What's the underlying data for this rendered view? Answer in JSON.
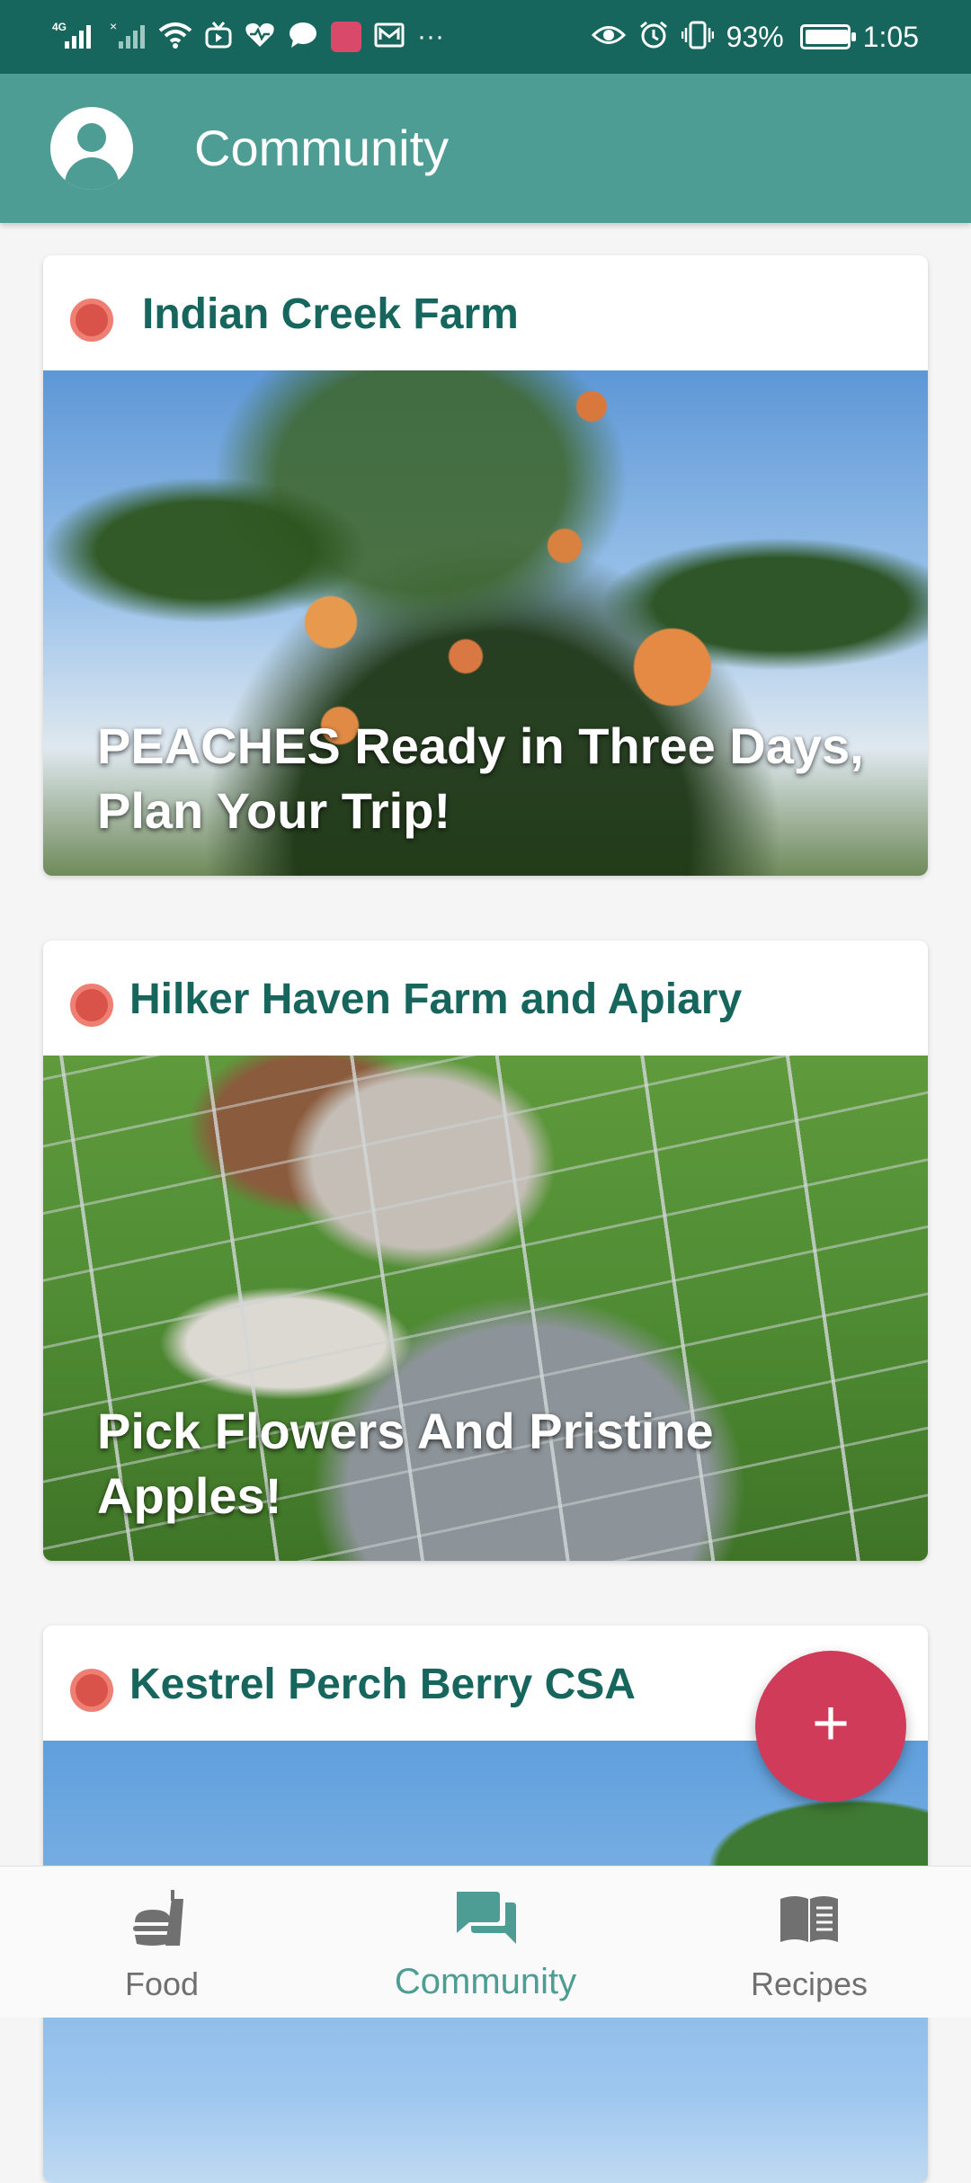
{
  "status_bar": {
    "network": "4G",
    "battery": "93%",
    "battery_level": 0.93,
    "time": "1:05",
    "icons": [
      "signal-icon",
      "signal-off-icon",
      "wifi-icon",
      "tv-icon",
      "health-icon",
      "chat-icon",
      "huawei-app-icon",
      "mail-icon",
      "more-icon",
      "eye-icon",
      "alarm-icon",
      "vibrate-icon",
      "battery-icon"
    ]
  },
  "app_bar": {
    "title": "Community",
    "avatar_icon": "account-circle-icon"
  },
  "posts": [
    {
      "farm": "Indian Creek Farm",
      "caption": "PEACHES Ready in Three Days, Plan Your Trip!",
      "image": "peach-tree-photo"
    },
    {
      "farm": "Hilker Haven Farm and Apiary",
      "caption": "Pick Flowers And Pristine Apples!",
      "image": "goats-fence-photo"
    },
    {
      "farm": "Kestrel Perch Berry CSA",
      "caption": "",
      "image": "sky-trees-photo"
    }
  ],
  "fab": {
    "label": "+",
    "icon": "add-icon"
  },
  "bottom_nav": {
    "active": "Community",
    "items": [
      {
        "label": "Food",
        "icon": "fastfood-icon"
      },
      {
        "label": "Community",
        "icon": "forum-icon"
      },
      {
        "label": "Recipes",
        "icon": "book-icon"
      }
    ]
  },
  "colors": {
    "status_bar": "#17665d",
    "app_bar": "#4d9d94",
    "accent": "#d03b5a",
    "title_text": "#17665d",
    "dot": "#d9534a"
  }
}
